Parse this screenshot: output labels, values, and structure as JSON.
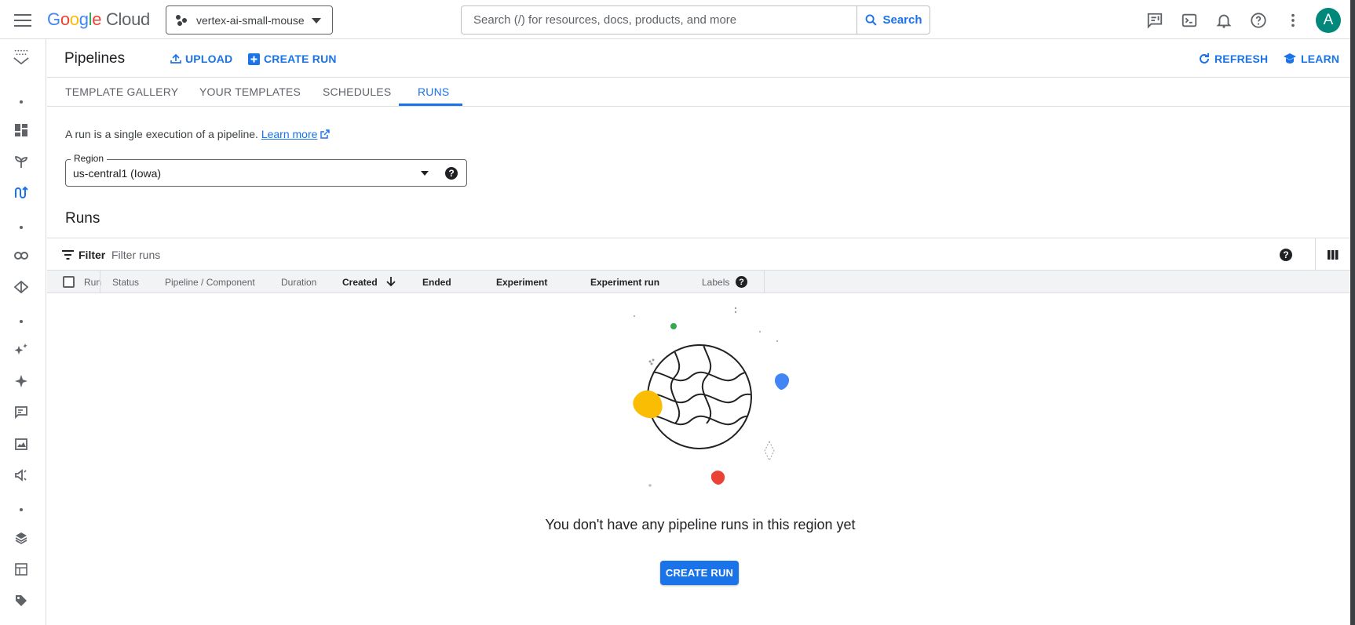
{
  "topbar": {
    "logo": {
      "g": "G",
      "o1": "o",
      "o2": "o",
      "g2": "g",
      "l": "l",
      "e": "e",
      "cloud": "Cloud"
    },
    "project_name": "vertex-ai-small-mouse",
    "search_placeholder": "Search (/) for resources, docs, products, and more",
    "search_button": "Search",
    "avatar_letter": "A",
    "icons": [
      "feedback-icon",
      "terminal-icon",
      "notifications-icon",
      "help-icon",
      "more-vert-icon"
    ]
  },
  "page": {
    "title": "Pipelines",
    "upload": "UPLOAD",
    "create_run": "CREATE RUN",
    "refresh": "REFRESH",
    "learn": "LEARN"
  },
  "tabs": [
    {
      "label": "TEMPLATE GALLERY",
      "active": false
    },
    {
      "label": "YOUR TEMPLATES",
      "active": false
    },
    {
      "label": "SCHEDULES",
      "active": false
    },
    {
      "label": "RUNS",
      "active": true
    }
  ],
  "intro": {
    "text": "A run is a single execution of a pipeline.",
    "link": "Learn more"
  },
  "region": {
    "label": "Region",
    "value": "us-central1 (Iowa)"
  },
  "runs": {
    "title": "Runs",
    "filter_label": "Filter",
    "filter_placeholder": "Filter runs",
    "columns": [
      "Run",
      "Status",
      "Pipeline / Component",
      "Duration",
      "Created",
      "Ended",
      "Experiment",
      "Experiment run",
      "Labels"
    ],
    "sorted_column": "Created",
    "empty_message": "You don't have any pipeline runs in this region yet",
    "empty_cta": "CREATE RUN"
  },
  "colors": {
    "accent": "#1a73e8",
    "avatar": "#00897b"
  }
}
